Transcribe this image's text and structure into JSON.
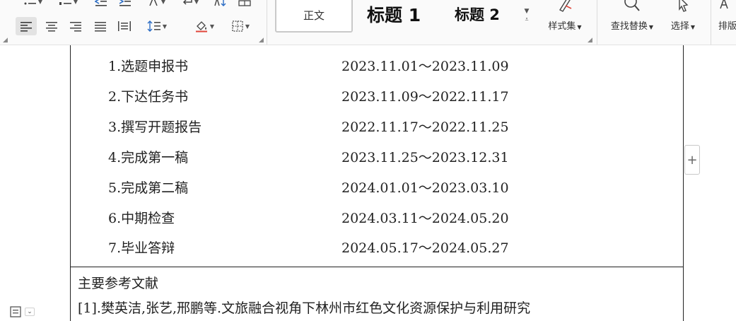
{
  "ribbon": {
    "styles": {
      "normal_label": "正文",
      "heading1_label": "标题 1",
      "heading2_label": "标题 2"
    },
    "style_set_label": "样式集",
    "find_replace_label": "查找替换",
    "select_label": "选择",
    "typeset_label": "排版"
  },
  "schedule": [
    {
      "task": "1.选题申报书",
      "dates": "2023.11.01～2023.11.09"
    },
    {
      "task": "2.下达任务书",
      "dates": "2023.11.09～2022.11.17"
    },
    {
      "task": "3.撰写开题报告",
      "dates": "2022.11.17～2022.11.25"
    },
    {
      "task": "4.完成第一稿",
      "dates": "2023.11.25～2023.12.31"
    },
    {
      "task": "5.完成第二稿",
      "dates": "2024.01.01～2023.03.10"
    },
    {
      "task": "6.中期检查",
      "dates": "2024.03.11～2024.05.20"
    },
    {
      "task": "7.毕业答辩",
      "dates": "2024.05.17～2024.05.27"
    }
  ],
  "references": {
    "title": "主要参考文献",
    "items": [
      "[1].樊英洁,张艺,邢鹏等.文旅融合视角下林州市红色文化资源保护与利用研究"
    ]
  },
  "icons": {
    "bullets": "bullets-icon",
    "numbering": "numbering-icon",
    "outdent": "outdent-icon",
    "indent": "indent-icon",
    "align_left": "align-left-icon",
    "align_center": "align-center-icon",
    "align_right": "align-right-icon",
    "justify": "justify-icon",
    "distributed": "distributed-icon",
    "line_spacing": "line-spacing-icon",
    "shading": "shading-icon",
    "borders": "borders-icon"
  }
}
